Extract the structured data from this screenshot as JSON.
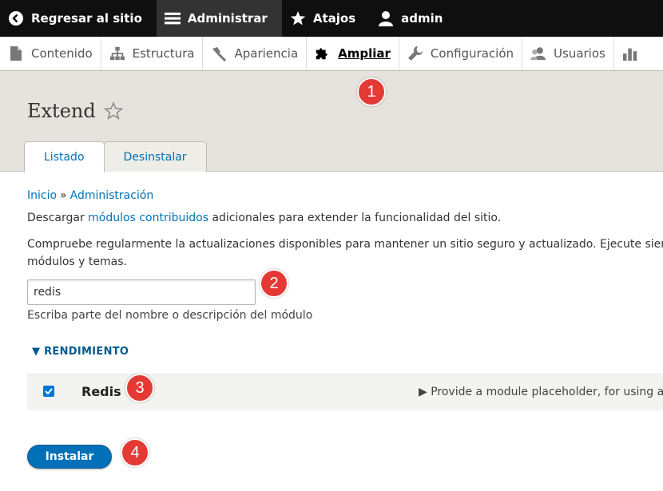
{
  "toolbar": {
    "back_label": "Regresar al sitio",
    "manage_label": "Administrar",
    "shortcuts_label": "Atajos",
    "user_label": "admin"
  },
  "tray": {
    "items": [
      {
        "label": "Contenido",
        "icon": "page-icon"
      },
      {
        "label": "Estructura",
        "icon": "sitemap-icon"
      },
      {
        "label": "Apariencia",
        "icon": "paintbrush-icon"
      },
      {
        "label": "Ampliar",
        "icon": "puzzle-icon"
      },
      {
        "label": "Configuración",
        "icon": "wrench-icon"
      },
      {
        "label": "Usuarios",
        "icon": "people-icon"
      }
    ]
  },
  "page": {
    "title": "Extend",
    "tabs": [
      "Listado",
      "Desinstalar"
    ]
  },
  "breadcrumb": {
    "home": "Inicio",
    "sep": "»",
    "admin": "Administración"
  },
  "description": {
    "line1_pre": "Descargar ",
    "line1_link": "módulos contribuidos",
    "line1_post": " adicionales para extender la funcionalidad del sitio.",
    "line2": "Compruebe regularmente la actualizaciones disponibles para mantener un sitio seguro y actualizado. Ejecute siem",
    "line3": "módulos y temas."
  },
  "filter": {
    "value": "redis",
    "hint": "Escriba parte del nombre o descripción del módulo"
  },
  "group": {
    "label": "▼ RENDIMIENTO"
  },
  "module": {
    "name": "Redis",
    "checked": true,
    "description": "▶ Provide a module placeholder, for using a"
  },
  "actions": {
    "install_label": "Instalar"
  },
  "markers": [
    "1",
    "2",
    "3",
    "4"
  ],
  "colors": {
    "accent": "#0071b8",
    "marker": "#e53935"
  }
}
